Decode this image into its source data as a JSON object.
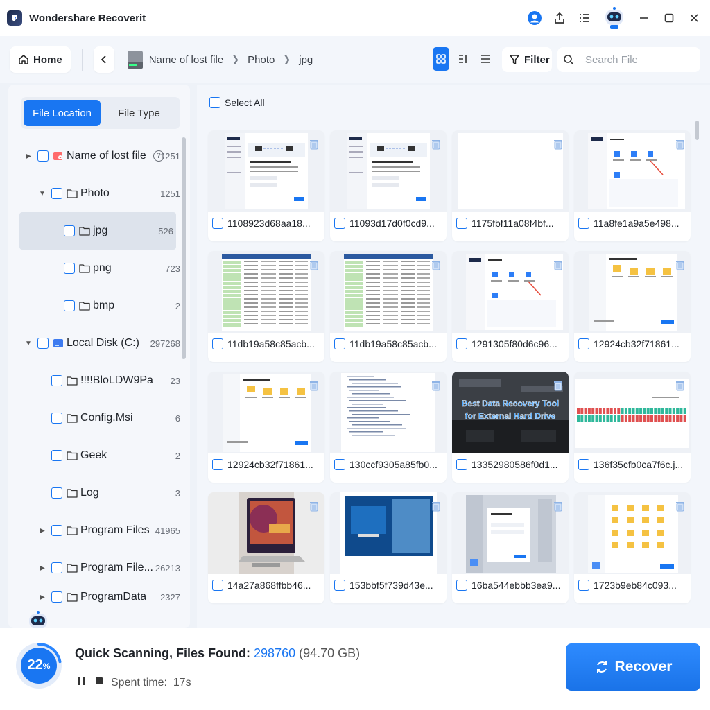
{
  "app": {
    "title": "Wondershare Recoverit"
  },
  "nav": {
    "home_label": "Home",
    "breadcrumb": [
      "Name of lost file",
      "Photo",
      "jpg"
    ],
    "filter_label": "Filter",
    "search_placeholder": "Search File"
  },
  "sidebar": {
    "tabs": [
      {
        "label": "File Location",
        "active": true
      },
      {
        "label": "File Type",
        "active": false
      }
    ],
    "tree": [
      {
        "label": "Name of lost file",
        "count": "1251",
        "level": 0,
        "arrow": "right",
        "icon": "lost-file-icon"
      },
      {
        "label": "Photo",
        "count": "1251",
        "level": 1,
        "arrow": "down",
        "icon": "folder-icon"
      },
      {
        "label": "jpg",
        "count": "526",
        "level": 2,
        "arrow": "",
        "icon": "folder-icon",
        "selected": true
      },
      {
        "label": "png",
        "count": "723",
        "level": 2,
        "arrow": "",
        "icon": "folder-icon"
      },
      {
        "label": "bmp",
        "count": "2",
        "level": 2,
        "arrow": "",
        "icon": "folder-icon"
      },
      {
        "label": "Local Disk (C:)",
        "count": "297268",
        "level": 0,
        "arrow": "down",
        "icon": "disk-icon"
      },
      {
        "label": "!!!!BloLDW9Pa",
        "count": "23",
        "level": 1,
        "arrow": "",
        "icon": "folder-icon"
      },
      {
        "label": "Config.Msi",
        "count": "6",
        "level": 1,
        "arrow": "",
        "icon": "folder-icon"
      },
      {
        "label": "Geek",
        "count": "2",
        "level": 1,
        "arrow": "",
        "icon": "folder-icon"
      },
      {
        "label": "Log",
        "count": "3",
        "level": 1,
        "arrow": "",
        "icon": "folder-icon"
      },
      {
        "label": "Program Files",
        "count": "41965",
        "level": 1,
        "arrow": "right",
        "icon": "folder-icon"
      },
      {
        "label": "Program File...",
        "count": "26213",
        "level": 1,
        "arrow": "right",
        "icon": "folder-icon"
      },
      {
        "label": "ProgramData",
        "count": "2327",
        "level": 1,
        "arrow": "right",
        "icon": "folder-icon"
      }
    ]
  },
  "main": {
    "select_all_label": "Select All",
    "files": [
      {
        "name": "1108923d68aa18...",
        "thumb": "screenshot-wizard"
      },
      {
        "name": "11093d17d0f0cd9...",
        "thumb": "screenshot-wizard"
      },
      {
        "name": "1175fbf11a08f4bf...",
        "thumb": "blank"
      },
      {
        "name": "11a8fe1a9a5e498...",
        "thumb": "screenshot-app"
      },
      {
        "name": "11db19a58c85acb...",
        "thumb": "spreadsheet"
      },
      {
        "name": "11db19a58c85acb...",
        "thumb": "spreadsheet"
      },
      {
        "name": "1291305f80d6c96...",
        "thumb": "screenshot-app"
      },
      {
        "name": "12924cb32f71861...",
        "thumb": "screenshot-folder"
      },
      {
        "name": "12924cb32f71861...",
        "thumb": "screenshot-folder"
      },
      {
        "name": "130ccf9305a85fb0...",
        "thumb": "document"
      },
      {
        "name": "13352980586f0d1...",
        "thumb": "banner",
        "banner_text": "Best Data Recovery Tool for External Hard Drive"
      },
      {
        "name": "136f35cfb0ca7f6c.j...",
        "thumb": "chart"
      },
      {
        "name": "14a27a868ffbb46...",
        "thumb": "photo-laptop"
      },
      {
        "name": "153bbf5f739d43e...",
        "thumb": "photo-blue"
      },
      {
        "name": "16ba544ebbb3ea9...",
        "thumb": "screenshot-dialog"
      },
      {
        "name": "1723b9eb84c093...",
        "thumb": "screenshot-files"
      }
    ]
  },
  "status": {
    "progress_value": "22",
    "progress_unit": "%",
    "progress_fraction": 0.22,
    "scan_label": "Quick Scanning, Files Found: ",
    "files_found": "298760",
    "size": " (94.70 GB)",
    "spent_label": "Spent time:",
    "spent_value": "17s",
    "recover_label": "Recover"
  },
  "colors": {
    "accent": "#1976f2",
    "bg": "#eef2f8"
  }
}
